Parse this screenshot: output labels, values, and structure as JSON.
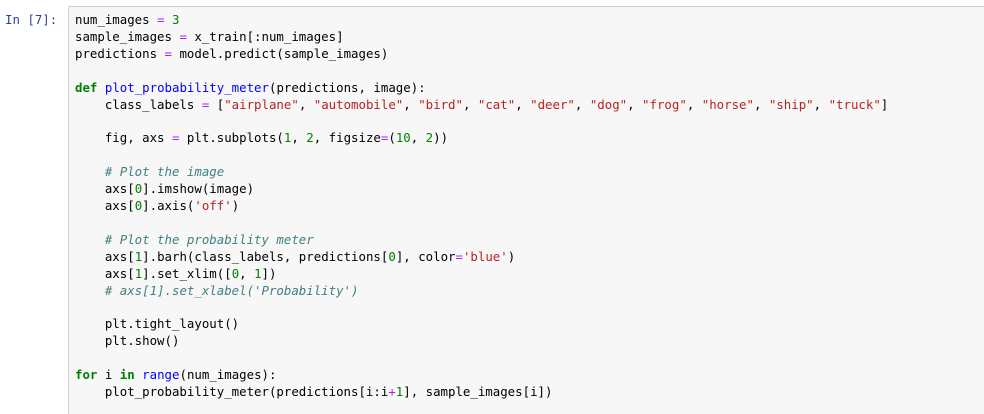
{
  "cell": {
    "prompt": "In [7]:",
    "lines": [
      [
        [
          "name",
          "num_images "
        ],
        [
          "op",
          "="
        ],
        [
          "name",
          " "
        ],
        [
          "num",
          "3"
        ]
      ],
      [
        [
          "name",
          "sample_images "
        ],
        [
          "op",
          "="
        ],
        [
          "name",
          " x_train[:num_images]"
        ]
      ],
      [
        [
          "name",
          "predictions "
        ],
        [
          "op",
          "="
        ],
        [
          "name",
          " model.predict(sample_images)"
        ]
      ],
      [],
      [
        [
          "kw",
          "def"
        ],
        [
          "name",
          " "
        ],
        [
          "fn",
          "plot_probability_meter"
        ],
        [
          "name",
          "(predictions, image):"
        ]
      ],
      [
        [
          "name",
          "    class_labels "
        ],
        [
          "op",
          "="
        ],
        [
          "name",
          " ["
        ],
        [
          "str",
          "\"airplane\""
        ],
        [
          "name",
          ", "
        ],
        [
          "str",
          "\"automobile\""
        ],
        [
          "name",
          ", "
        ],
        [
          "str",
          "\"bird\""
        ],
        [
          "name",
          ", "
        ],
        [
          "str",
          "\"cat\""
        ],
        [
          "name",
          ", "
        ],
        [
          "str",
          "\"deer\""
        ],
        [
          "name",
          ", "
        ],
        [
          "str",
          "\"dog\""
        ],
        [
          "name",
          ", "
        ],
        [
          "str",
          "\"frog\""
        ],
        [
          "name",
          ", "
        ],
        [
          "str",
          "\"horse\""
        ],
        [
          "name",
          ", "
        ],
        [
          "str",
          "\"ship\""
        ],
        [
          "name",
          ", "
        ],
        [
          "str",
          "\"truck\""
        ],
        [
          "name",
          "]"
        ]
      ],
      [],
      [
        [
          "name",
          "    fig, axs "
        ],
        [
          "op",
          "="
        ],
        [
          "name",
          " plt.subplots("
        ],
        [
          "num",
          "1"
        ],
        [
          "name",
          ", "
        ],
        [
          "num",
          "2"
        ],
        [
          "name",
          ", figsize"
        ],
        [
          "op",
          "="
        ],
        [
          "name",
          "("
        ],
        [
          "num",
          "10"
        ],
        [
          "name",
          ", "
        ],
        [
          "num",
          "2"
        ],
        [
          "name",
          "))"
        ]
      ],
      [],
      [
        [
          "name",
          "    "
        ],
        [
          "cmt",
          "# Plot the image"
        ]
      ],
      [
        [
          "name",
          "    axs["
        ],
        [
          "num",
          "0"
        ],
        [
          "name",
          "].imshow(image)"
        ]
      ],
      [
        [
          "name",
          "    axs["
        ],
        [
          "num",
          "0"
        ],
        [
          "name",
          "].axis("
        ],
        [
          "str",
          "'off'"
        ],
        [
          "name",
          ")"
        ]
      ],
      [],
      [
        [
          "name",
          "    "
        ],
        [
          "cmt",
          "# Plot the probability meter"
        ]
      ],
      [
        [
          "name",
          "    axs["
        ],
        [
          "num",
          "1"
        ],
        [
          "name",
          "].barh(class_labels, predictions["
        ],
        [
          "num",
          "0"
        ],
        [
          "name",
          "], color"
        ],
        [
          "op",
          "="
        ],
        [
          "str",
          "'blue'"
        ],
        [
          "name",
          ")"
        ]
      ],
      [
        [
          "name",
          "    axs["
        ],
        [
          "num",
          "1"
        ],
        [
          "name",
          "].set_xlim(["
        ],
        [
          "num",
          "0"
        ],
        [
          "name",
          ", "
        ],
        [
          "num",
          "1"
        ],
        [
          "name",
          "])"
        ]
      ],
      [
        [
          "name",
          "    "
        ],
        [
          "cmt",
          "# axs[1].set_xlabel('Probability')"
        ]
      ],
      [],
      [
        [
          "name",
          "    plt.tight_layout()"
        ]
      ],
      [
        [
          "name",
          "    plt.show()"
        ]
      ],
      [],
      [
        [
          "kw",
          "for"
        ],
        [
          "name",
          " i "
        ],
        [
          "kw",
          "in"
        ],
        [
          "name",
          " "
        ],
        [
          "fn",
          "range"
        ],
        [
          "name",
          "(num_images):"
        ]
      ],
      [
        [
          "name",
          "    plot_probability_meter(predictions[i:i"
        ],
        [
          "op",
          "+"
        ],
        [
          "num",
          "1"
        ],
        [
          "name",
          "], sample_images[i])"
        ]
      ]
    ]
  }
}
